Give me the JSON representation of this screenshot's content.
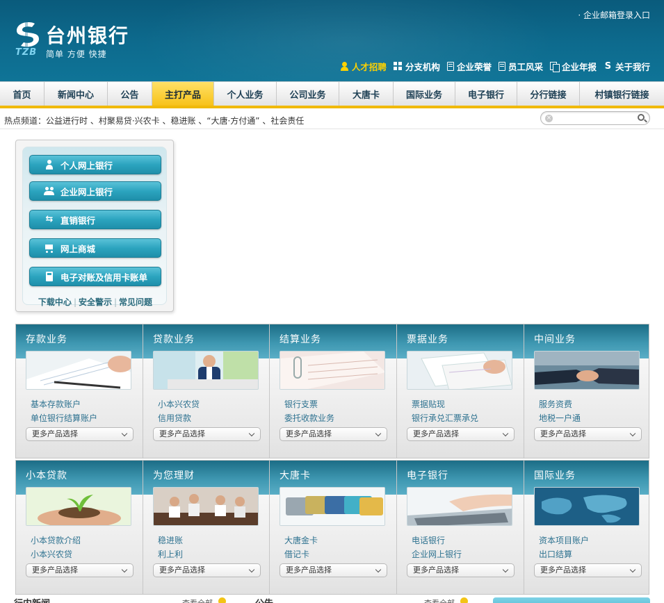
{
  "header": {
    "logo_name": "台州银行",
    "logo_abbr": "TZB",
    "logo_slogan": "简单 方便 快捷",
    "mail_login": "· 企业邮箱登录入口",
    "links": [
      {
        "label": "人才招聘",
        "icon": "person-icon",
        "highlight": true
      },
      {
        "label": "分支机构",
        "icon": "grid-icon"
      },
      {
        "label": "企业荣誉",
        "icon": "document-icon"
      },
      {
        "label": "员工风采",
        "icon": "document-icon"
      },
      {
        "label": "企业年报",
        "icon": "documents-icon"
      },
      {
        "label": "关于我行",
        "icon": "logo-s-icon"
      }
    ]
  },
  "nav": {
    "items": [
      "首页",
      "新闻中心",
      "公告",
      "主打产品",
      "个人业务",
      "公司业务",
      "大唐卡",
      "国际业务",
      "电子银行",
      "分行链接",
      "村镇银行链接"
    ],
    "active_index": 3
  },
  "hot_channel": {
    "text": "热点频道：公益进行时 、村聚易贷·兴农卡 、稳进账 、“大唐·方付通” 、社会责任"
  },
  "search": {
    "value": "",
    "placeholder": ""
  },
  "quick_access": {
    "buttons": [
      {
        "label": "个人网上银行",
        "icon": "person-icon"
      },
      {
        "label": "企业网上银行",
        "icon": "group-icon"
      },
      {
        "label": "直销银行",
        "icon": "exchange-icon"
      },
      {
        "label": "网上商城",
        "icon": "cart-icon"
      },
      {
        "label": "电子对账及信用卡账单",
        "icon": "calculator-icon"
      }
    ],
    "links": [
      "下载中心",
      "安全警示",
      "常见问题"
    ]
  },
  "products": {
    "select_label": "更多产品选择",
    "row1": [
      {
        "title": "存款业务",
        "links": [
          "基本存款账户",
          "单位银行结算账户"
        ]
      },
      {
        "title": "贷款业务",
        "links": [
          "小本兴农贷",
          "信用贷款"
        ]
      },
      {
        "title": "结算业务",
        "links": [
          "银行支票",
          "委托收款业务"
        ]
      },
      {
        "title": "票据业务",
        "links": [
          "票据贴现",
          "银行承兑汇票承兑"
        ]
      },
      {
        "title": "中间业务",
        "links": [
          "服务资费",
          "地税一户通"
        ]
      }
    ],
    "row2": [
      {
        "title": "小本贷款",
        "links": [
          "小本贷款介绍",
          "小本兴农贷"
        ]
      },
      {
        "title": "为您理财",
        "links": [
          "稳进账",
          "利上利"
        ]
      },
      {
        "title": "大唐卡",
        "links": [
          "大唐金卡",
          "借记卡"
        ]
      },
      {
        "title": "电子银行",
        "links": [
          "电话银行",
          "企业网上银行"
        ]
      },
      {
        "title": "国际业务",
        "links": [
          "资本项目账户",
          "出口结算"
        ]
      }
    ]
  },
  "bottom": {
    "news_title": "行内新闻",
    "news_more": "查看全部",
    "notice_title": "公告",
    "notice_more": "查看全部"
  },
  "colors": {
    "header_bg": "#0d6b8e",
    "nav_active": "#f7c21a",
    "accent_teal": "#2ca4bf",
    "link_blue": "#2e7290"
  }
}
